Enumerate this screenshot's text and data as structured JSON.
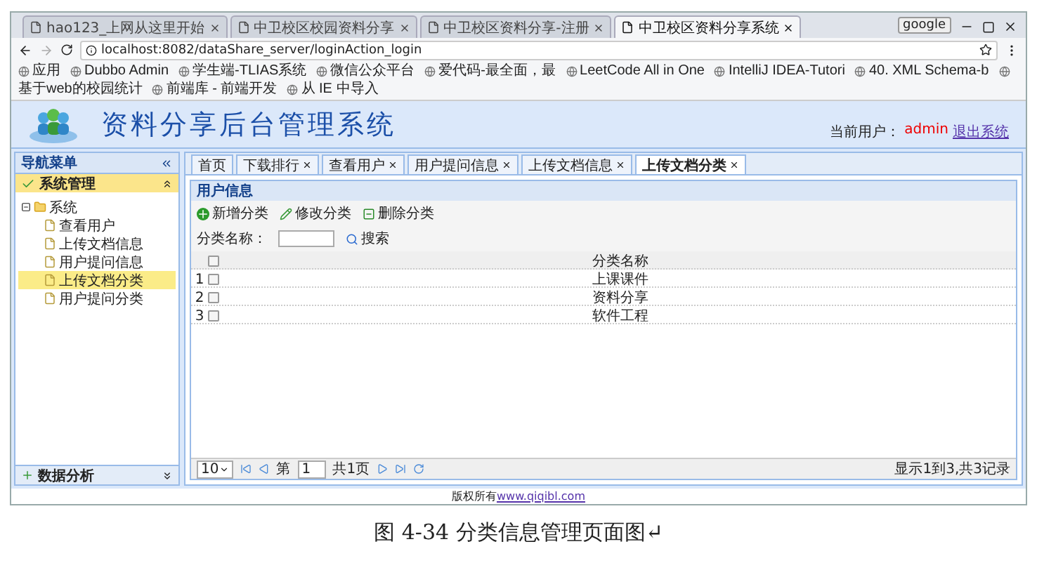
{
  "browser_tabs": [
    {
      "label": "hao123_上网从这里开始",
      "selected": false
    },
    {
      "label": "中卫校区校园资料分享",
      "selected": false
    },
    {
      "label": "中卫校区资料分享-注册",
      "selected": false
    },
    {
      "label": "中卫校区资料分享系统",
      "selected": true
    }
  ],
  "window_button": "google",
  "address": "localhost:8082/dataShare_server/loginAction_login",
  "bookmarks": [
    "应用",
    "Dubbo Admin",
    "学生端-TLIAS系统",
    "微信公众平台",
    "爱代码-最全面，最",
    "LeetCode All in One",
    "IntelliJ IDEA-Tutori",
    "40. XML Schema-b",
    "基于web的校园统计",
    "前端库 - 前端开发",
    "从 IE 中导入"
  ],
  "app": {
    "title": "资料分享后台管理系统",
    "user_label": "当前用户：",
    "user": "admin",
    "logout": "退出系统"
  },
  "sidebar": {
    "title": "导航菜单",
    "sections": [
      {
        "label": "系统管理",
        "expanded": true,
        "tree": [
          {
            "label": "系统",
            "expanded": true,
            "children": [
              {
                "label": "查看用户",
                "selected": false
              },
              {
                "label": "上传文档信息",
                "selected": false
              },
              {
                "label": "用户提问信息",
                "selected": false
              },
              {
                "label": "上传文档分类",
                "selected": true
              },
              {
                "label": "用户提问分类",
                "selected": false
              }
            ]
          }
        ]
      },
      {
        "label": "数据分析",
        "expanded": false
      }
    ]
  },
  "tabs": [
    {
      "label": "首页",
      "selected": false,
      "closable": false
    },
    {
      "label": "下载排行",
      "selected": false,
      "closable": true
    },
    {
      "label": "查看用户",
      "selected": false,
      "closable": true
    },
    {
      "label": "用户提问信息",
      "selected": false,
      "closable": true
    },
    {
      "label": "上传文档信息",
      "selected": false,
      "closable": true
    },
    {
      "label": "上传文档分类",
      "selected": true,
      "closable": true
    }
  ],
  "panel": {
    "title": "用户信息",
    "toolbar": [
      {
        "label": "新增分类",
        "kind": "add"
      },
      {
        "label": "修改分类",
        "kind": "edit"
      },
      {
        "label": "删除分类",
        "kind": "delete"
      }
    ],
    "search": {
      "label": "分类名称：",
      "button": "搜索"
    },
    "header_checked": false,
    "columns": [
      "分类名称"
    ],
    "rows": [
      {
        "num": "1",
        "name": "上课课件",
        "checked": false
      },
      {
        "num": "2",
        "name": "资料分享",
        "checked": false
      },
      {
        "num": "3",
        "name": "软件工程",
        "checked": false
      }
    ]
  },
  "pager": {
    "page_size": "10",
    "page_prefix": "第",
    "page": "1",
    "total": "共1页",
    "summary": "显示1到3,共3记录"
  },
  "footer": {
    "text": "版权所有",
    "link": "www.qiqibl.com"
  },
  "caption": "图 4-34 分类信息管理页面图↵"
}
